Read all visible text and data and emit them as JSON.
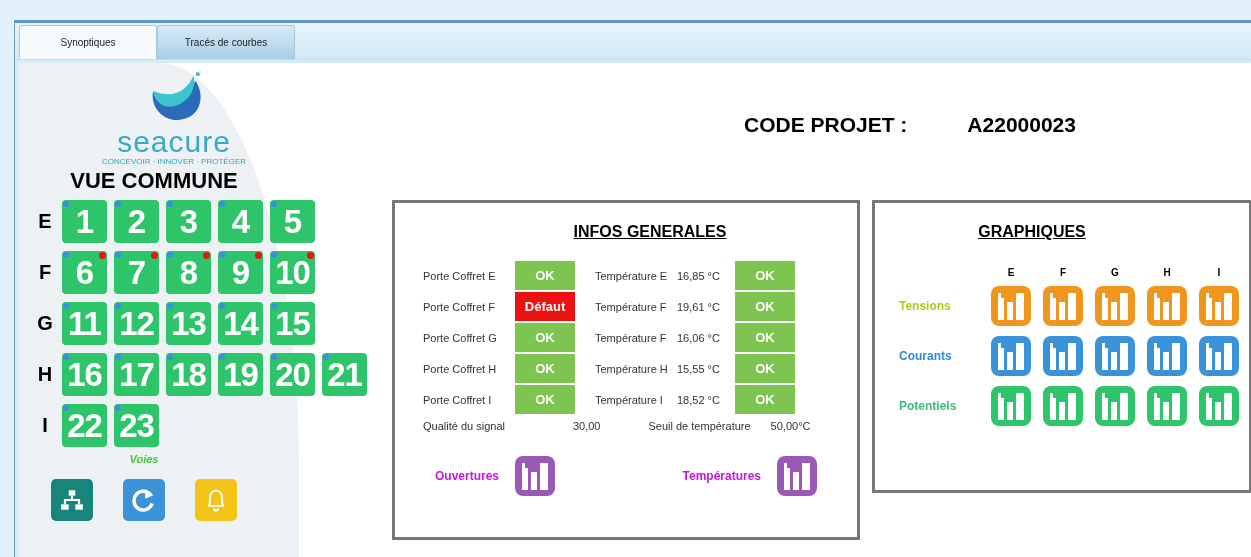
{
  "tabs": [
    {
      "label": "Synoptiques",
      "selected": true
    },
    {
      "label": "Tracés de courbes",
      "selected": false
    }
  ],
  "sidebar": {
    "logo": {
      "name": "seacure",
      "tagline": "CONCEVOIR · INNOVER · PROTÉGER"
    },
    "title": "VUE COMMUNE",
    "groups": [
      {
        "letter": "E",
        "channels": [
          {
            "number": "1",
            "alarm": false
          },
          {
            "number": "2",
            "alarm": false
          },
          {
            "number": "3",
            "alarm": false
          },
          {
            "number": "4",
            "alarm": false
          },
          {
            "number": "5",
            "alarm": false
          }
        ]
      },
      {
        "letter": "F",
        "channels": [
          {
            "number": "6",
            "alarm": true
          },
          {
            "number": "7",
            "alarm": true
          },
          {
            "number": "8",
            "alarm": true
          },
          {
            "number": "9",
            "alarm": true
          },
          {
            "number": "10",
            "alarm": true
          }
        ]
      },
      {
        "letter": "G",
        "channels": [
          {
            "number": "11",
            "alarm": false
          },
          {
            "number": "12",
            "alarm": false
          },
          {
            "number": "13",
            "alarm": false
          },
          {
            "number": "14",
            "alarm": false
          },
          {
            "number": "15",
            "alarm": false
          }
        ]
      },
      {
        "letter": "H",
        "channels": [
          {
            "number": "16",
            "alarm": false
          },
          {
            "number": "17",
            "alarm": false
          },
          {
            "number": "18",
            "alarm": false
          },
          {
            "number": "19",
            "alarm": false
          },
          {
            "number": "20",
            "alarm": false
          },
          {
            "number": "21",
            "alarm": false
          }
        ]
      },
      {
        "letter": "I",
        "channels": [
          {
            "number": "22",
            "alarm": false
          },
          {
            "number": "23",
            "alarm": false
          }
        ]
      }
    ],
    "caption": "Voies",
    "tools": [
      {
        "kind": "network"
      },
      {
        "kind": "refresh"
      },
      {
        "kind": "alarm"
      }
    ]
  },
  "project": {
    "label": "CODE PROJET :",
    "value": "A22000023"
  },
  "infos": {
    "title": "INFOS GENERALES",
    "rows": [
      {
        "door": "Porte Coffret E",
        "door_status": {
          "text": "OK",
          "fault": false
        },
        "temp_label": "Température E",
        "temp_value": "16,85 °C",
        "temp_status": {
          "text": "OK",
          "fault": false
        }
      },
      {
        "door": "Porte Coffret F",
        "door_status": {
          "text": "Défaut",
          "fault": true
        },
        "temp_label": "Température F",
        "temp_value": "19,61 °C",
        "temp_status": {
          "text": "OK",
          "fault": false
        }
      },
      {
        "door": "Porte Coffret G",
        "door_status": {
          "text": "OK",
          "fault": false
        },
        "temp_label": "Température F",
        "temp_value": "16,06 °C",
        "temp_status": {
          "text": "OK",
          "fault": false
        }
      },
      {
        "door": "Porte Coffret H",
        "door_status": {
          "text": "OK",
          "fault": false
        },
        "temp_label": "Température H",
        "temp_value": "15,55 °C",
        "temp_status": {
          "text": "OK",
          "fault": false
        }
      },
      {
        "door": "Porte Coffret I",
        "door_status": {
          "text": "OK",
          "fault": false
        },
        "temp_label": "Température I",
        "temp_value": "18,52 °C",
        "temp_status": {
          "text": "OK",
          "fault": false
        }
      }
    ],
    "signal": {
      "label": "Qualité du signal",
      "value": "30,00"
    },
    "threshold": {
      "label": "Seuil de température",
      "value": "50,00°C"
    },
    "charts": [
      {
        "label": "Ouvertures"
      },
      {
        "label": "Températures"
      }
    ]
  },
  "graphs": {
    "title": "GRAPHIQUES",
    "columns": [
      "E",
      "F",
      "G",
      "H",
      "I"
    ],
    "rows": [
      {
        "label": {
          "text": "Tensions",
          "color": "#b5c61a"
        },
        "color": "#f0961e"
      },
      {
        "label": {
          "text": "Courants",
          "color": "#2f8ae0"
        },
        "color": "#3a93d8"
      },
      {
        "label": {
          "text": "Potentiels",
          "color": "#3cc07a"
        },
        "color": "#2ec46a"
      }
    ]
  }
}
